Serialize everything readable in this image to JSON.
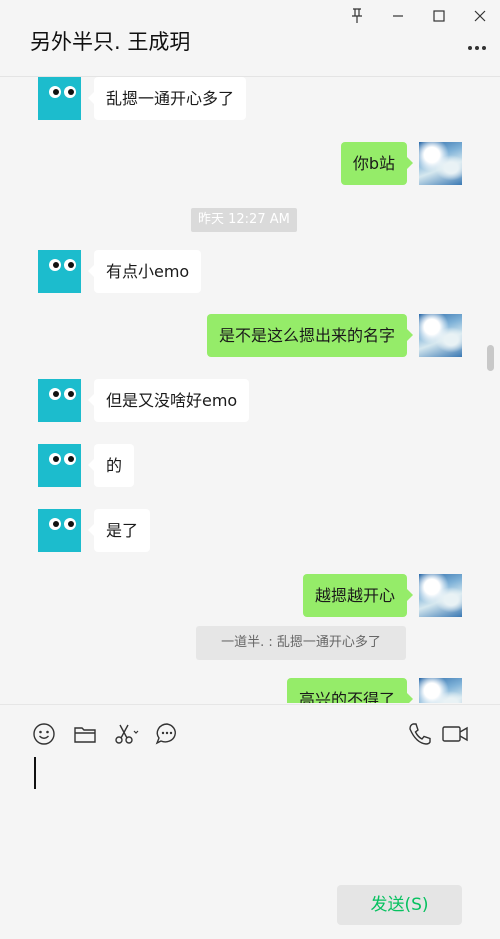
{
  "window": {
    "title": "另外半只. 王成玥"
  },
  "messages": [
    {
      "side": "other",
      "text": "乱摁一通开心多了"
    },
    {
      "side": "me",
      "text": "你b站"
    },
    {
      "side": "system",
      "text": "昨天 12:27 AM"
    },
    {
      "side": "other",
      "text": "有点小emo"
    },
    {
      "side": "me",
      "text": "是不是这么摁出来的名字"
    },
    {
      "side": "other",
      "text": "但是又没啥好emo"
    },
    {
      "side": "other",
      "text": "的"
    },
    {
      "side": "other",
      "text": "是了"
    },
    {
      "side": "me",
      "text": "越摁越开心"
    },
    {
      "side": "quote",
      "text": "一道半. : 乱摁一通开心多了"
    },
    {
      "side": "me",
      "text": "高兴的不得了"
    }
  ],
  "input": {
    "value": "",
    "send_label": "发送(S)"
  },
  "icons": {
    "pin": "pin-icon",
    "minimize": "minimize-icon",
    "maximize": "maximize-icon",
    "close": "close-icon",
    "more": "more-icon",
    "emoji": "emoji-icon",
    "folder": "folder-icon",
    "scissors": "scissors-icon",
    "chat_history": "chat-history-icon",
    "voice_call": "phone-icon",
    "video_call": "video-icon"
  },
  "colors": {
    "my_bubble": "#95ec69",
    "other_bubble": "#ffffff",
    "avatar_other": "#1cbccd",
    "send_text": "#07c160"
  }
}
